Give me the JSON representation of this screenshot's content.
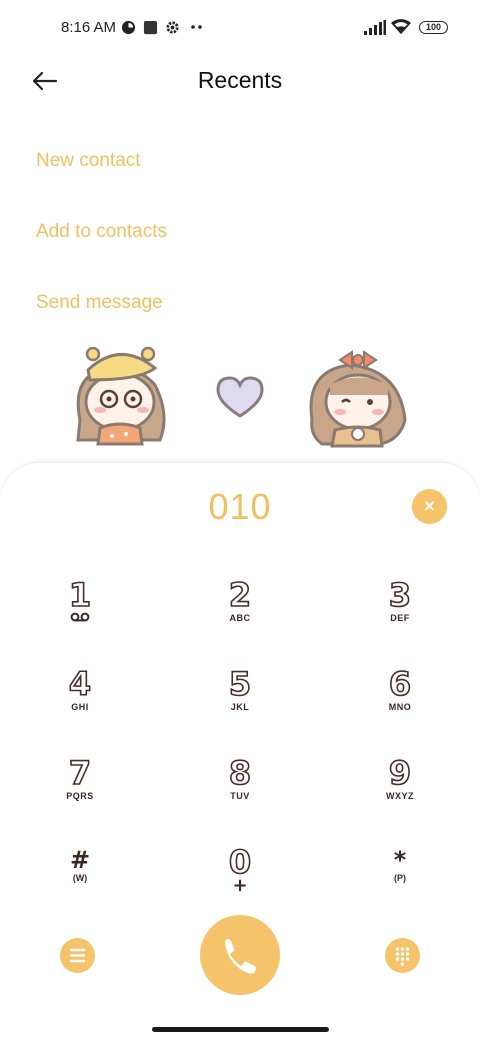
{
  "status_bar": {
    "time": "8:16 AM",
    "battery": "100"
  },
  "header": {
    "title": "Recents"
  },
  "actions": [
    {
      "label": "New contact"
    },
    {
      "label": "Add to contacts"
    },
    {
      "label": "Send message"
    }
  ],
  "dialer": {
    "number": "010",
    "clear_symbol": "×",
    "keys": [
      {
        "digit": "1",
        "letters": ""
      },
      {
        "digit": "2",
        "letters": "ABC"
      },
      {
        "digit": "3",
        "letters": "DEF"
      },
      {
        "digit": "4",
        "letters": "GHI"
      },
      {
        "digit": "5",
        "letters": "JKL"
      },
      {
        "digit": "6",
        "letters": "MNO"
      },
      {
        "digit": "7",
        "letters": "PQRS"
      },
      {
        "digit": "8",
        "letters": "TUV"
      },
      {
        "digit": "9",
        "letters": "WXYZ"
      },
      {
        "digit": "#",
        "letters": "(W)"
      },
      {
        "digit": "0",
        "letters": "+"
      },
      {
        "digit": "*",
        "letters": "(P)"
      }
    ]
  },
  "icons": {
    "back": "arrow-left-icon",
    "menu": "menu-icon",
    "call": "phone-icon",
    "keypad": "dialpad-icon",
    "voicemail": "voicemail-icon"
  },
  "colors": {
    "accent": "#f5c46a",
    "accent_text": "#f0c060",
    "key_outline": "#4a2b25"
  }
}
